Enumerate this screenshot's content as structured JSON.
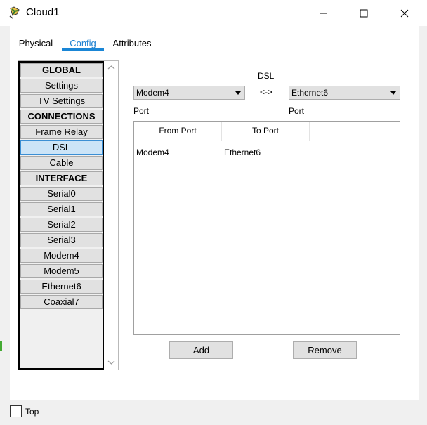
{
  "window": {
    "title": "Cloud1",
    "icon": "cloud-device-icon",
    "minimize_icon": "minimize-icon",
    "maximize_icon": "maximize-icon",
    "close_icon": "close-icon"
  },
  "tabs": [
    {
      "label": "Physical",
      "active": false
    },
    {
      "label": "Config",
      "active": true
    },
    {
      "label": "Attributes",
      "active": false
    }
  ],
  "sidebar": {
    "items": [
      {
        "label": "GLOBAL",
        "kind": "header"
      },
      {
        "label": "Settings",
        "kind": "item"
      },
      {
        "label": "TV Settings",
        "kind": "item"
      },
      {
        "label": "CONNECTIONS",
        "kind": "header"
      },
      {
        "label": "Frame Relay",
        "kind": "item"
      },
      {
        "label": "DSL",
        "kind": "item",
        "selected": true
      },
      {
        "label": "Cable",
        "kind": "item"
      },
      {
        "label": "INTERFACE",
        "kind": "header"
      },
      {
        "label": "Serial0",
        "kind": "item"
      },
      {
        "label": "Serial1",
        "kind": "item"
      },
      {
        "label": "Serial2",
        "kind": "item"
      },
      {
        "label": "Serial3",
        "kind": "item"
      },
      {
        "label": "Modem4",
        "kind": "item"
      },
      {
        "label": "Modem5",
        "kind": "item"
      },
      {
        "label": "Ethernet6",
        "kind": "item"
      },
      {
        "label": "Coaxial7",
        "kind": "item"
      }
    ]
  },
  "dsl": {
    "heading": "DSL",
    "arrow": "<->",
    "left_port_value": "Modem4",
    "left_port_label": "Port",
    "right_port_value": "Ethernet6",
    "right_port_label": "Port"
  },
  "table": {
    "columns": [
      "From Port",
      "To Port"
    ],
    "rows": [
      {
        "from": "Modem4",
        "to": "Ethernet6"
      }
    ]
  },
  "buttons": {
    "add": "Add",
    "remove": "Remove"
  },
  "footer": {
    "top_label": "Top",
    "top_checked": false
  },
  "colors": {
    "accent": "#1a86d6",
    "selected_bg": "#cce4f7"
  }
}
